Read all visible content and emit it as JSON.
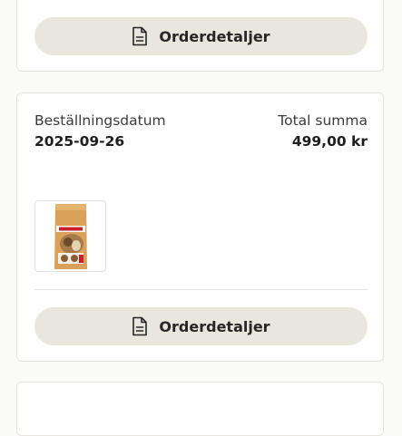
{
  "orders": [
    {
      "details_button_label": "Orderdetaljer"
    },
    {
      "order_date_label": "Beställningsdatum",
      "order_date": "2025-09-26",
      "total_label": "Total summa",
      "total": "499,00 kr",
      "product_image": "cat-food-bag",
      "details_button_label": "Orderdetaljer"
    }
  ],
  "colors": {
    "button_bg": "#e9e6dd",
    "card_border": "#e6e4de",
    "page_bg": "#fafaf8"
  }
}
